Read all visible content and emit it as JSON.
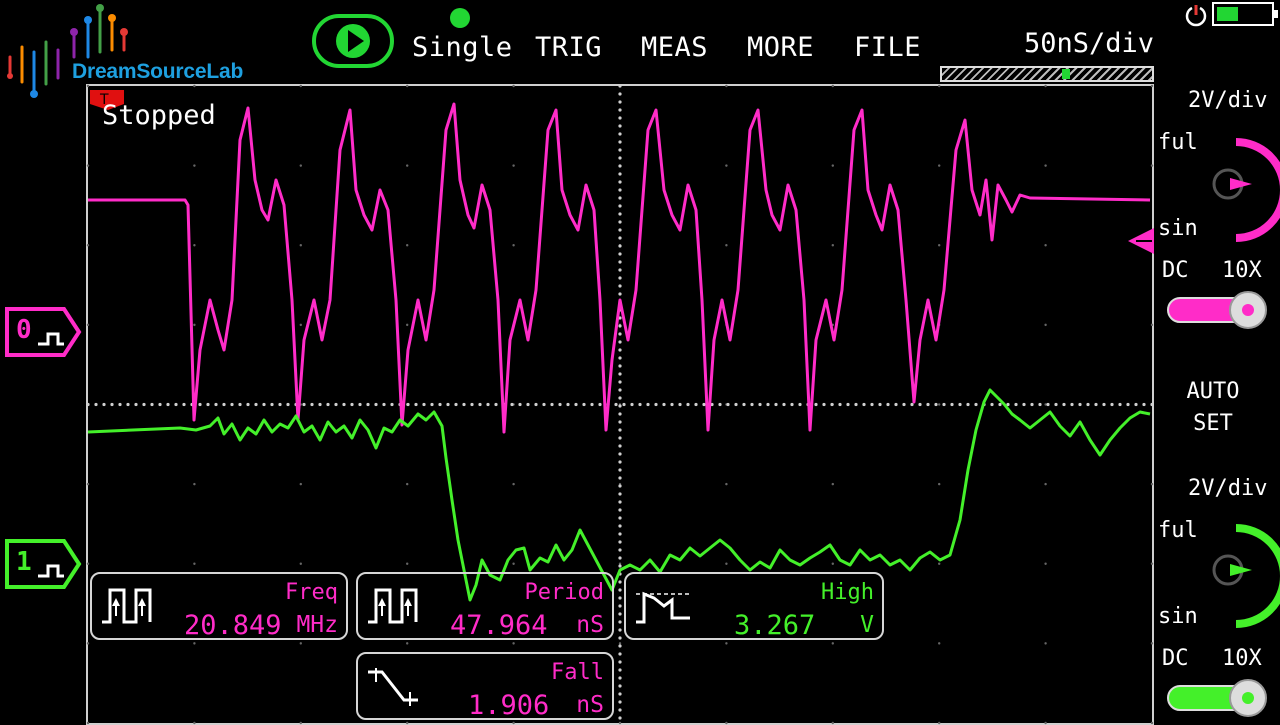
{
  "logo": {
    "text": "DreamSourceLab"
  },
  "toolbar": {
    "run_state": "play",
    "single": "Single",
    "trig": "TRIG",
    "meas": "MEAS",
    "more": "MORE",
    "file": "FILE",
    "timebase": "50nS/div"
  },
  "status": {
    "text": "Stopped",
    "battery_level_percent": 40
  },
  "channels": [
    {
      "id": "0",
      "color": "#ff2cc8",
      "volts_div": "2V/div",
      "bw_full": "ful",
      "bw_sin": "sin",
      "coupling": "DC",
      "probe": "10X"
    },
    {
      "id": "1",
      "color": "#44f02a",
      "volts_div": "2V/div",
      "bw_full": "ful",
      "bw_sin": "sin",
      "coupling": "DC",
      "probe": "10X"
    }
  ],
  "autoset": {
    "line1": "AUTO",
    "line2": "SET"
  },
  "measurements": [
    {
      "name": "Freq",
      "value": "20.849",
      "unit": "MHz",
      "color": "#ff2cc8",
      "icon": "square-wave-icon"
    },
    {
      "name": "Period",
      "value": "47.964",
      "unit": "nS",
      "color": "#ff2cc8",
      "icon": "square-wave-icon"
    },
    {
      "name": "High",
      "value": "3.267",
      "unit": "V",
      "color": "#44f02a",
      "icon": "high-level-icon"
    },
    {
      "name": "Fall",
      "value": "1.906",
      "unit": "nS",
      "color": "#ff2cc8",
      "icon": "falling-edge-icon"
    }
  ],
  "colors": {
    "accent_green": "#22d633",
    "ch0": "#ff2cc8",
    "ch1": "#44f02a",
    "grid": "#9a9a9a"
  }
}
